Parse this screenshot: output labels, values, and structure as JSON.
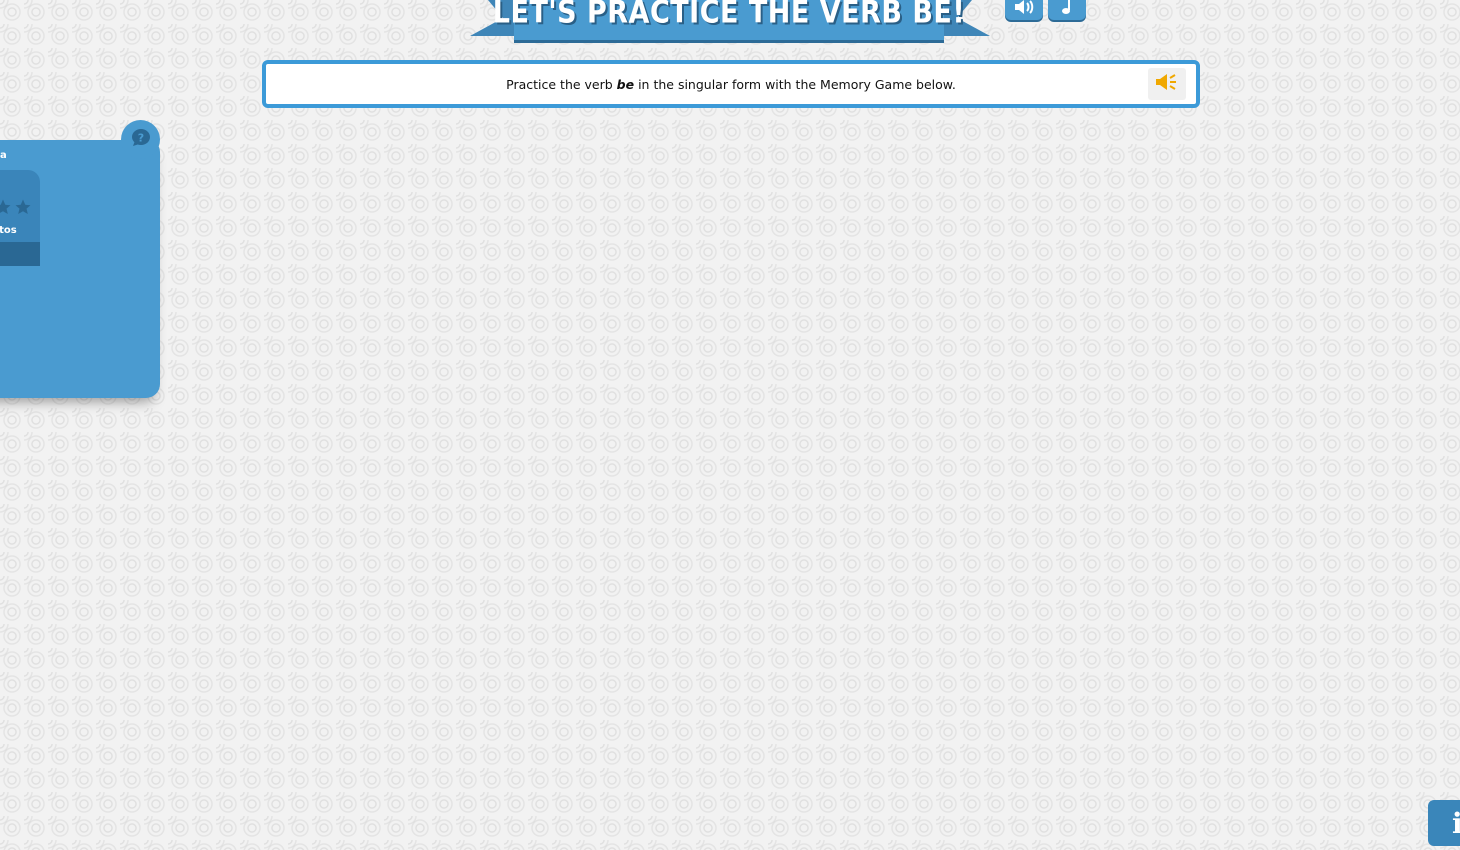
{
  "header": {
    "title": "LET'S PRACTICE THE VERB BE!",
    "sound_button_icon": "volume-icon",
    "music_button_icon": "music-note-icon"
  },
  "instruction": {
    "text_before": "Practice the verb ",
    "verb": "be",
    "text_after": " in the singular form with the Memory Game below.",
    "audio_button_icon": "speaker-icon"
  },
  "side_panel": {
    "help_icon": "question-bubble-icon",
    "label": "a",
    "score_label": "ntos",
    "star_icon": "star-icon"
  },
  "info_button": {
    "label": "i"
  },
  "colors": {
    "accent_blue": "#4a9bd0",
    "dark_blue": "#2d6b97",
    "speaker_orange": "#f0a800",
    "border_blue": "#3c9ad8"
  }
}
